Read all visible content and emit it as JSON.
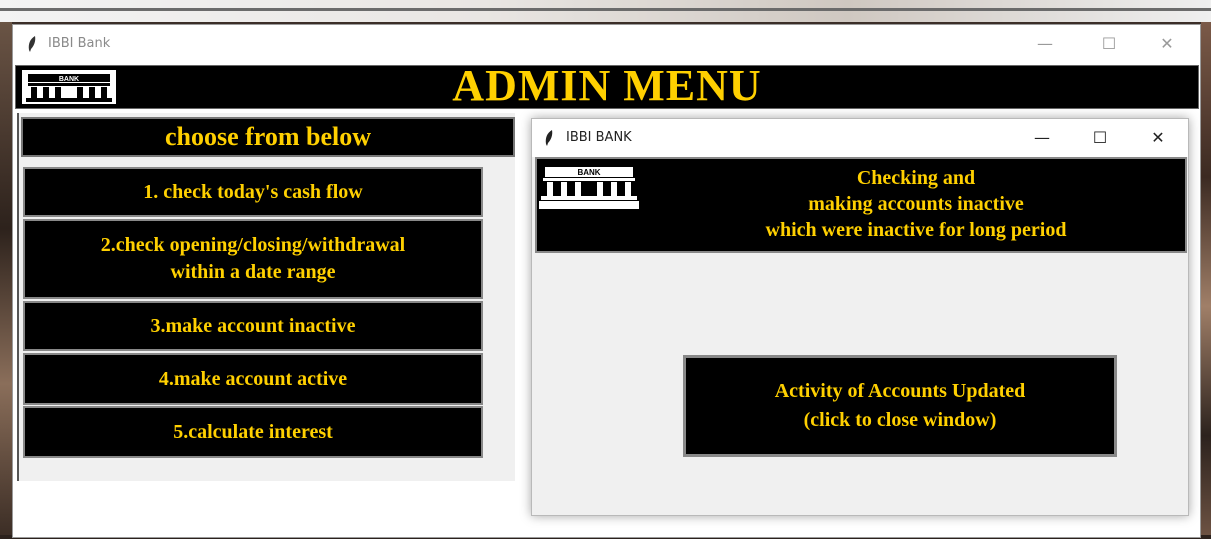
{
  "main_window": {
    "title": "IBBI Bank",
    "header_title": "ADMIN MENU",
    "logo_text": "BANK",
    "choose_label": "choose from below",
    "menu_items": [
      {
        "line1": "1. check today's cash flow",
        "line2": ""
      },
      {
        "line1": "2.check opening/closing/withdrawal",
        "line2": "within a date range"
      },
      {
        "line1": "3.make account inactive",
        "line2": ""
      },
      {
        "line1": "4.make account active",
        "line2": ""
      },
      {
        "line1": "5.calculate interest",
        "line2": ""
      }
    ],
    "controls": {
      "minimize": "—",
      "maximize": "☐",
      "close": "✕"
    }
  },
  "sub_window": {
    "title": "IBBI BANK",
    "logo_text": "BANK",
    "header_lines": [
      "Checking and",
      "making accounts inactive",
      "which were inactive for long period"
    ],
    "activity_lines": [
      "Activity of Accounts Updated",
      "(click to close window)"
    ],
    "controls": {
      "minimize": "—",
      "maximize": "☐",
      "close": "✕"
    }
  },
  "colors": {
    "accent_text": "#ffd000",
    "panel_bg": "#000000"
  }
}
